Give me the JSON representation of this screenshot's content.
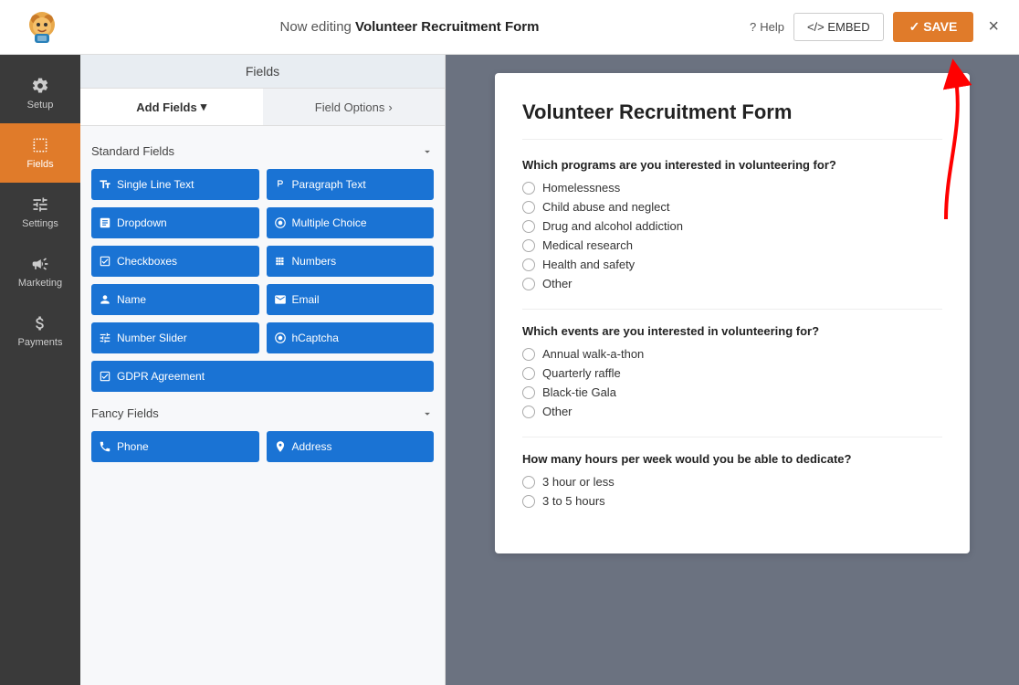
{
  "topBar": {
    "editingLabel": "Now editing ",
    "formName": "Volunteer Recruitment Form",
    "helpLabel": "Help",
    "embedLabel": "</> EMBED",
    "saveLabel": "✓ SAVE",
    "closeLabel": "×"
  },
  "sidebarNav": {
    "items": [
      {
        "id": "setup",
        "label": "Setup",
        "icon": "gear"
      },
      {
        "id": "fields",
        "label": "Fields",
        "icon": "fields",
        "active": true
      },
      {
        "id": "settings",
        "label": "Settings",
        "icon": "sliders"
      },
      {
        "id": "marketing",
        "label": "Marketing",
        "icon": "megaphone"
      },
      {
        "id": "payments",
        "label": "Payments",
        "icon": "dollar"
      }
    ]
  },
  "fieldsPanel": {
    "header": "Fields",
    "tabs": [
      {
        "id": "add-fields",
        "label": "Add Fields",
        "chevron": "▾",
        "active": true
      },
      {
        "id": "field-options",
        "label": "Field Options",
        "chevron": "›"
      }
    ],
    "standardSection": {
      "label": "Standard Fields",
      "buttons": [
        {
          "id": "single-line-text",
          "label": "Single Line Text",
          "icon": "T"
        },
        {
          "id": "paragraph-text",
          "label": "Paragraph Text",
          "icon": "¶"
        },
        {
          "id": "dropdown",
          "label": "Dropdown",
          "icon": "□"
        },
        {
          "id": "multiple-choice",
          "label": "Multiple Choice",
          "icon": "◎"
        },
        {
          "id": "checkboxes",
          "label": "Checkboxes",
          "icon": "☑"
        },
        {
          "id": "numbers",
          "label": "Numbers",
          "icon": "#"
        },
        {
          "id": "name",
          "label": "Name",
          "icon": "👤"
        },
        {
          "id": "email",
          "label": "Email",
          "icon": "✉"
        },
        {
          "id": "number-slider",
          "label": "Number Slider",
          "icon": "⇔"
        },
        {
          "id": "hcaptcha",
          "label": "hCaptcha",
          "icon": "◉"
        },
        {
          "id": "gdpr-agreement",
          "label": "GDPR Agreement",
          "icon": "☑"
        }
      ]
    },
    "fancySection": {
      "label": "Fancy Fields",
      "buttons": [
        {
          "id": "phone",
          "label": "Phone",
          "icon": "☎"
        },
        {
          "id": "address",
          "label": "Address",
          "icon": "📍"
        }
      ]
    }
  },
  "formPreview": {
    "title": "Volunteer Recruitment Form",
    "sections": [
      {
        "question": "Which programs are you interested in volunteering for?",
        "options": [
          "Homelessness",
          "Child abuse and neglect",
          "Drug and alcohol addiction",
          "Medical research",
          "Health and safety",
          "Other"
        ]
      },
      {
        "question": "Which events are you interested in volunteering for?",
        "options": [
          "Annual walk-a-thon",
          "Quarterly raffle",
          "Black-tie Gala",
          "Other"
        ]
      },
      {
        "question": "How many hours per week would you be able to dedicate?",
        "options": [
          "3 hour or less",
          "3 to 5 hours"
        ]
      }
    ]
  }
}
